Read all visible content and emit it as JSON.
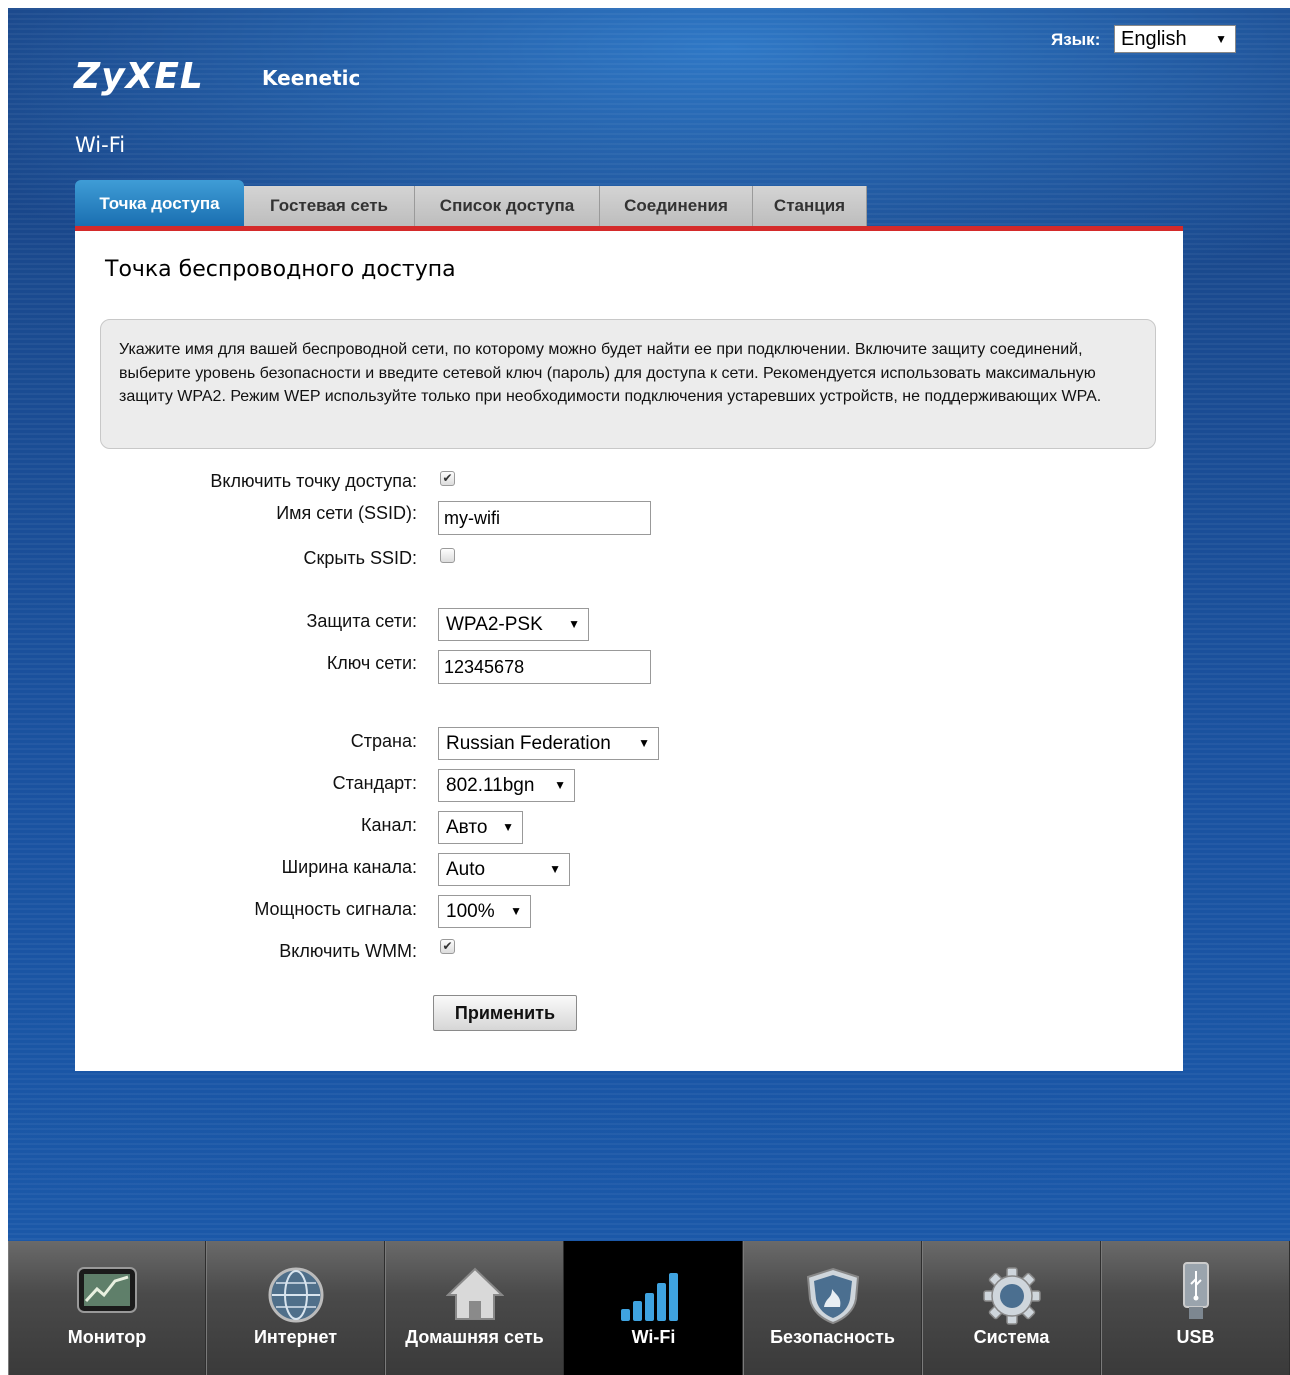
{
  "header": {
    "brand": "ZyXEL",
    "product": "Keenetic",
    "page_title": "Wi-Fi",
    "language_label": "Язык:",
    "language_value": "English"
  },
  "tabs": [
    {
      "label": "Точка доступа",
      "active": true
    },
    {
      "label": "Гостевая сеть",
      "active": false
    },
    {
      "label": "Список доступа",
      "active": false
    },
    {
      "label": "Соединения",
      "active": false
    },
    {
      "label": "Станция",
      "active": false
    }
  ],
  "panel": {
    "title": "Точка беспроводного доступа",
    "info": "Укажите имя для вашей беспроводной сети, по которому можно будет найти ее при подключении. Включите защиту соединений, выберите уровень безопасности и введите сетевой ключ (пароль) для доступа к сети. Рекомендуется использовать максимальную защиту WPA2. Режим WEP используйте только при необходимости подключения устаревших устройств, не поддерживающих WPA."
  },
  "form": {
    "enable_ap_label": "Включить точку доступа:",
    "enable_ap_checked": true,
    "ssid_label": "Имя сети (SSID):",
    "ssid_value": "my-wifi",
    "hide_ssid_label": "Скрыть SSID:",
    "hide_ssid_checked": false,
    "security_label": "Защита сети:",
    "security_value": "WPA2-PSK",
    "key_label": "Ключ сети:",
    "key_value": "12345678",
    "country_label": "Страна:",
    "country_value": "Russian Federation",
    "standard_label": "Стандарт:",
    "standard_value": "802.11bgn",
    "channel_label": "Канал:",
    "channel_value": "Авто",
    "width_label": "Ширина канала:",
    "width_value": "Auto",
    "power_label": "Мощность сигнала:",
    "power_value": "100%",
    "wmm_label": "Включить WMM:",
    "wmm_checked": true,
    "apply_label": "Применить"
  },
  "bottom_nav": [
    {
      "label": "Монитор",
      "icon": "monitor-icon",
      "active": false
    },
    {
      "label": "Интернет",
      "icon": "globe-icon",
      "active": false
    },
    {
      "label": "Домашняя сеть",
      "icon": "home-icon",
      "active": false
    },
    {
      "label": "Wi-Fi",
      "icon": "wifi-signal-icon",
      "active": true
    },
    {
      "label": "Безопасность",
      "icon": "shield-icon",
      "active": false
    },
    {
      "label": "Система",
      "icon": "gear-icon",
      "active": false
    },
    {
      "label": "USB",
      "icon": "usb-icon",
      "active": false
    }
  ],
  "colors": {
    "background_blue": "#1a52a0",
    "active_tab": "#1a6fb1",
    "panel_accent": "#d42a2a"
  }
}
